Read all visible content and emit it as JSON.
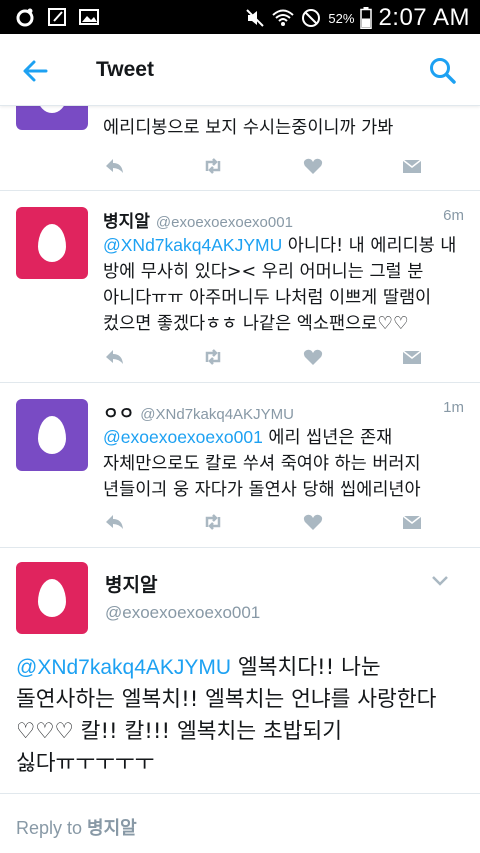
{
  "status_bar": {
    "battery_percent": "52%",
    "time": "2:07 AM"
  },
  "app_bar": {
    "title": "Tweet"
  },
  "tweets": [
    {
      "text": "에리디봉으로 보지 수시는중이니까 가봐"
    },
    {
      "name": "병지알",
      "handle": "@exoexoexoexo001",
      "time": "6m",
      "avatar_color": "#e0245e",
      "mention": "@XNd7kakq4AKJYMU",
      "text": " 아니다! 내 에리디봉 내 방에 무사히 있다>< 우리 어머니는 그럴 분 아니다ㅠㅠ 아주머니두 나처럼 이쁘게 딸램이 컸으면 좋겠다ㅎㅎ 나같은 엑소팬으로♡♡"
    },
    {
      "name": "ㅇㅇ",
      "handle": "@XNd7kakq4AKJYMU",
      "time": "1m",
      "avatar_color": "#794bc4",
      "mention": "@exoexoexoexo001",
      "text": " 에리 씹년은 존재 자체만으로도 칼로 쑤셔 죽여야 하는 버러지 년들이긔 웅 자다가 돌연사 당해 씹에리년아"
    }
  ],
  "detail": {
    "name": "병지알",
    "handle": "@exoexoexoexo001",
    "avatar_color": "#e0245e",
    "mention": "@XNd7kakq4AKJYMU",
    "text": " 엘복치다!! 나눈 돌연사하는 엘복치!! 엘복치는 언냐를 사랑한다♡♡♡ 칼!! 칼!!! 엘복치는 초밥되기 싫다ㅠㅜㅜㅜㅜ"
  },
  "reply_bar": {
    "prefix": "Reply to ",
    "name": "병지알"
  },
  "colors": {
    "accent": "#1da1f2",
    "muted": "#8899a6",
    "action_icon": "#aab8c2"
  }
}
